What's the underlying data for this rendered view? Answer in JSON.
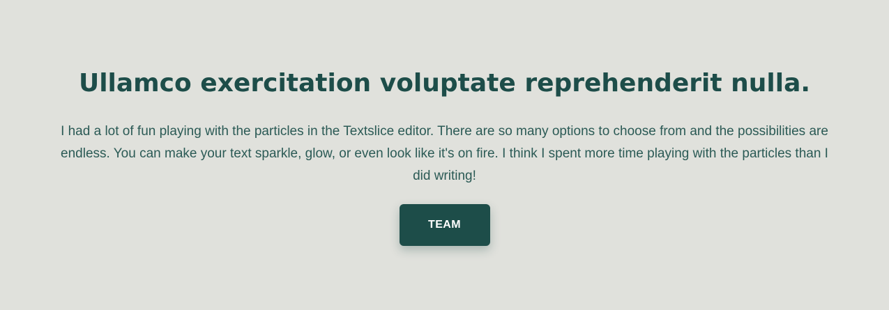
{
  "hero": {
    "title": "Ullamco exercitation voluptate reprehenderit nulla.",
    "body": "I had a lot of fun playing with the particles in the Textslice editor. There are so many options to choose from and the possibilities are endless. You can make your text sparkle, glow, or even look like it's on fire. I think I spent more time playing with the particles than I did writing!",
    "button_label": "TEAM"
  },
  "colors": {
    "background": "#e0e1dc",
    "accent": "#1d4d49",
    "text": "#2b5a55",
    "button_text": "#ffffff"
  }
}
